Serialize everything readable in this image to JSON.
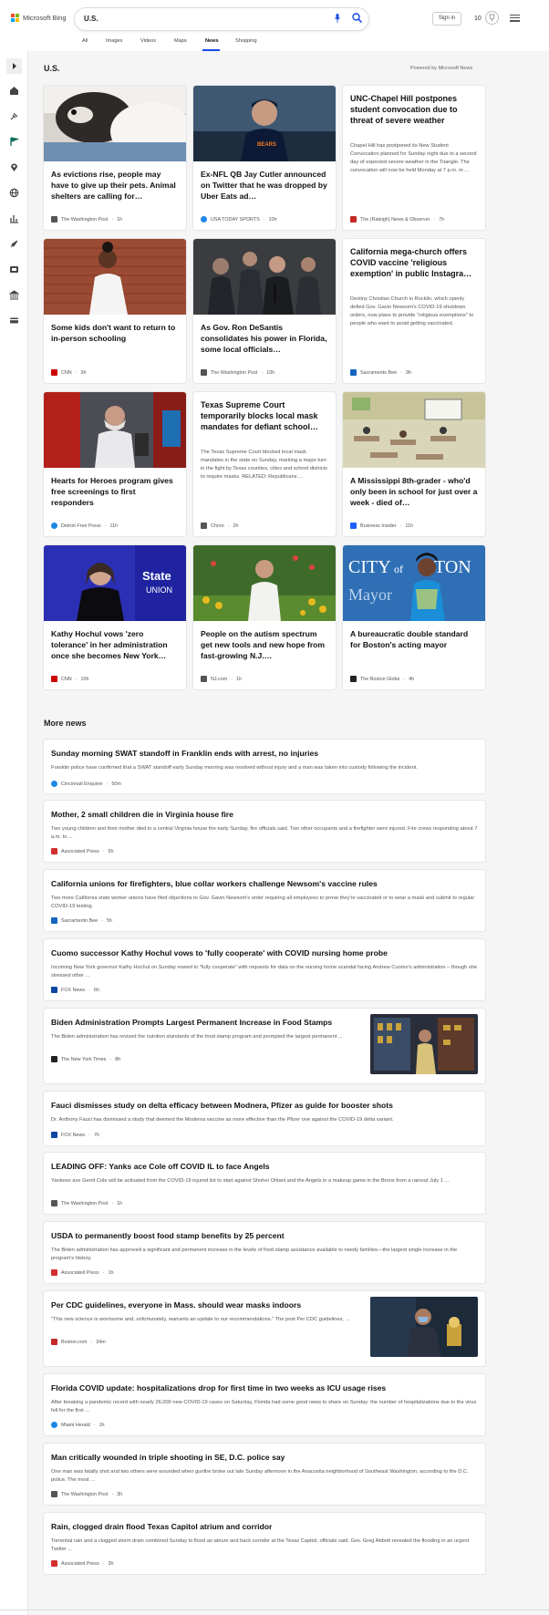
{
  "header": {
    "brand": "Microsoft Bing",
    "query": "U.S.",
    "signin": "Sign in",
    "points": "10"
  },
  "tabs": [
    "All",
    "Images",
    "Videos",
    "Maps",
    "News",
    "Shopping"
  ],
  "active_tab": "News",
  "sidebar_icons": [
    "expand-arrow-icon",
    "home-icon",
    "discover-icon",
    "flag-icon",
    "location-pin-icon",
    "globe-icon",
    "business-chart-icon",
    "rocket-icon",
    "entertainment-icon",
    "bank-icon",
    "card-icon"
  ],
  "section": {
    "title": "U.S.",
    "powered": "Powered by Microsoft News"
  },
  "cards": [
    {
      "title": "As evictions rise, people may have to give up their pets. Animal shelters are calling for…",
      "source": "The Washington Post",
      "time": "1h",
      "color": "#555555"
    },
    {
      "title": "Ex-NFL QB Jay Cutler announced on Twitter that he was dropped by Uber Eats ad…",
      "source": "USA TODAY SPORTS",
      "time": "10h",
      "color": "#1e88e5"
    },
    {
      "title": "UNC-Chapel Hill postpones student convocation due to threat of severe weather",
      "snippet": "Chapel Hill has postponed its New Student Convocation planned for Sunday night due to a second day of expected severe weather in the Triangle. The convocation will now be held Monday at 7 p.m. in ...",
      "source": "The (Raleigh) News & Observer",
      "time": "7h",
      "color": "#c62828"
    },
    {
      "title": "Some kids don't want to return to in-person schooling",
      "source": "CNN",
      "time": "3h",
      "color": "#cc0000"
    },
    {
      "title": "As Gov. Ron DeSantis consolidates his power in Florida, some local officials…",
      "source": "The Washington Post",
      "time": "10h",
      "color": "#555555"
    },
    {
      "title": "California mega-church offers COVID vaccine 'religious exemption' in public Instagra…",
      "snippet": "Destiny Christian Church in Rocklin, which openly defied Gov. Gavin Newsom's COVID-19 shutdown orders, now plans to provide \"religious exemptions\" to people who want to avoid getting vaccinated.",
      "source": "Sacramento Bee",
      "time": "9h",
      "color": "#1565c0"
    },
    {
      "title": "Hearts for Heroes program gives free screenings to first responders",
      "source": "Detroit Free Press",
      "time": "11h",
      "color": "#1e88e5"
    },
    {
      "title": "Texas Supreme Court temporarily blocks local mask mandates for defiant school…",
      "snippet": "The Texas Supreme Court blocked local mask mandates in the state on Sunday, marking a major turn in the fight by Texas counties, cities and school districts to require masks. RELATED: Republicans ...",
      "source": "Chron",
      "time": "2h",
      "color": "#555555"
    },
    {
      "title": "A Mississippi 8th-grader - who'd only been in school for just over a week - died of…",
      "source": "Business Insider",
      "time": "11h",
      "color": "#1e5eff"
    },
    {
      "title": "Kathy Hochul vows 'zero tolerance' in her administration once she becomes New York…",
      "source": "CNN",
      "time": "10h",
      "color": "#cc0000"
    },
    {
      "title": "People on the autism spectrum get new tools and new hope from fast-growing N.J.…",
      "source": "NJ.com",
      "time": "1h",
      "color": "#555555"
    },
    {
      "title": "A bureaucratic double standard for Boston's acting mayor",
      "source": "The Boston Globe",
      "time": "4h",
      "color": "#222222"
    }
  ],
  "more": {
    "title": "More news"
  },
  "news": [
    {
      "title": "Sunday morning SWAT standoff in Franklin ends with arrest, no injuries",
      "snippet": "Franklin police have confirmed that a SWAT standoff early Sunday morning was resolved without injury and a man was taken into custody following the incident.",
      "source": "Cincinnati Enquirer",
      "time": "50m",
      "color": "#1e88e5"
    },
    {
      "title": "Mother, 2 small children die in Virginia house fire",
      "snippet": "Two young children and their mother died in a central Virginia house fire early Sunday, fire officials said. Two other occupants and a firefighter were injured. Fire crews responding about 7 a.m. to ...",
      "source": "Associated Press",
      "time": "5h",
      "color": "#d32f2f"
    },
    {
      "title": "California unions for firefighters, blue collar workers challenge Newsom's vaccine rules",
      "snippet": "Two more California state worker unions have filed objections to Gov. Gavin Newsom's order requiring all employees to prove they're vaccinated or to wear a mask and submit to regular COVID-19 testing.",
      "source": "Sacramento Bee",
      "time": "5h",
      "color": "#1565c0"
    },
    {
      "title": "Cuomo successor Kathy Hochul vows to 'fully cooperate' with COVID nursing home probe",
      "snippet": "Incoming New York governor Kathy Hochul on Sunday vowed to \"fully cooperate\" with requests for data on the nursing home scandal facing Andrew Cuomo's administration – though she stressed other ...",
      "source": "FOX News",
      "time": "6h",
      "color": "#0d47a1"
    },
    {
      "title": "Biden Administration Prompts Largest Permanent Increase in Food Stamps",
      "snippet": "The Biden administration has revised the nutrition standards of the food stamp program and prompted the largest permanent ...",
      "source": "The New York Times",
      "time": "8h",
      "color": "#222222"
    },
    {
      "title": "Fauci dismisses study on delta efficacy between Modnera, Pfizer as guide for booster shots",
      "snippet": "Dr. Anthony Fauci has dismissed a study that deemed the Moderna vaccine as more effective than the Pfizer one against the COVID-19 delta variant.",
      "source": "FOX News",
      "time": "7h",
      "color": "#0d47a1"
    },
    {
      "title": "LEADING OFF: Yanks ace Cole off COVID IL to face Angels",
      "snippet": "Yankees ace Gerrit Cole will be activated from the COVID-19 injured list to start against Shohei Ohtani and the Angels in a makeup game in the Bronx from a rainout July 1 ...",
      "source": "The Washington Post",
      "time": "1h",
      "color": "#555555"
    },
    {
      "title": "USDA to permanently boost food stamp benefits by 25 percent",
      "snippet": "The Biden administration has approved a significant and permanent increase in the levels of food stamp assistance available to needy families—the largest single increase in the program's history.",
      "source": "Associated Press",
      "time": "1h",
      "color": "#d32f2f"
    },
    {
      "title": "Per CDC guidelines, everyone in Mass. should wear masks indoors",
      "snippet": "\"This new science is worrisome and, unfortunately, warrants an update to our recommendations.\" The post Per CDC guidelines, ...",
      "source": "Boston.com",
      "time": "34m",
      "color": "#c62828"
    },
    {
      "title": "Florida COVID update: hospitalizations drop for first time in two weeks as ICU usage rises",
      "snippet": "After breaking a pandemic record with nearly 26,000 new COVID-19 cases on Saturday, Florida had some good news to share on Sunday: the number of hospitalizations due to the virus fell for the first ...",
      "source": "Miami Herald",
      "time": "1h",
      "color": "#1e88e5"
    },
    {
      "title": "Man critically wounded in triple shooting in SE, D.C. police say",
      "snippet": "One man was fatally shot and two others were wounded when gunfire broke out late Sunday afternoon in the Anacostia neighborhood of Southeast Washington, according to the D.C. police. The most ...",
      "source": "The Washington Post",
      "time": "3h",
      "color": "#555555"
    },
    {
      "title": "Rain, clogged drain flood Texas Capitol atrium and corridor",
      "snippet": "Torrential rain and a clogged storm drain combined Sunday to flood an atrium and back corridor at the Texas Capitol, officials said. Gov. Greg Abbott revealed the flooding in an urgent Twitter ...",
      "source": "Associated Press",
      "time": "3h",
      "color": "#d32f2f"
    }
  ]
}
